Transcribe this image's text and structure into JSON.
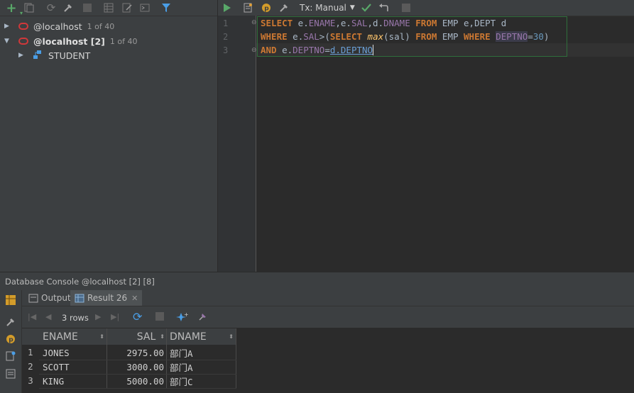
{
  "tree": {
    "items": [
      {
        "label": "@localhost",
        "count": "1 of 40",
        "expanded": false
      },
      {
        "label": "@localhost [2]",
        "count": "1 of 40",
        "expanded": true
      },
      {
        "label": "STUDENT"
      }
    ]
  },
  "editor": {
    "tx_mode": "Tx: Manual",
    "line_numbers": [
      "1",
      "2",
      "3"
    ],
    "lines": {
      "l1": {
        "kw1": "SELECT",
        "t1": " e.",
        "f1": "ENAME",
        "t2": ",e.",
        "f2": "SAL",
        "t3": ",d.",
        "f3": "DNAME",
        "t4": " ",
        "kw2": "FROM",
        "t5": " EMP e,DEPT d"
      },
      "l2": {
        "kw1": "WHERE",
        "t1": " e.",
        "f1": "SAL",
        "t2": ">(",
        "kw2": "SELECT",
        "t3": " ",
        "fn": "max",
        "t4": "(sal) ",
        "kw3": "FROM",
        "t5": " EMP ",
        "kw4": "WHERE",
        "t6": " ",
        "f2": "DEPTNO",
        "t7": "=",
        "num": "30",
        "t8": ")"
      },
      "l3": {
        "kw1": "AND",
        "t1": " e.",
        "f1": "DEPTNO",
        "t2": "=",
        "f2": "d.DEPTNO"
      }
    }
  },
  "console": {
    "title": "Database Console @localhost [2] [8]",
    "tabs": [
      "Output",
      "Result 26"
    ],
    "rows_label": "3 rows"
  },
  "result": {
    "columns": [
      "ENAME",
      "SAL",
      "DNAME"
    ],
    "rows": [
      {
        "num": "1",
        "ename": "JONES",
        "sal": "2975.00",
        "dname": "部门A"
      },
      {
        "num": "2",
        "ename": "SCOTT",
        "sal": "3000.00",
        "dname": "部门A"
      },
      {
        "num": "3",
        "ename": "KING",
        "sal": "5000.00",
        "dname": "部门C"
      }
    ]
  },
  "colors": {
    "keyword": "#cc7832",
    "field": "#9876aa",
    "number": "#6897bb",
    "oracle": "#d0383a",
    "run": "#59a869"
  }
}
